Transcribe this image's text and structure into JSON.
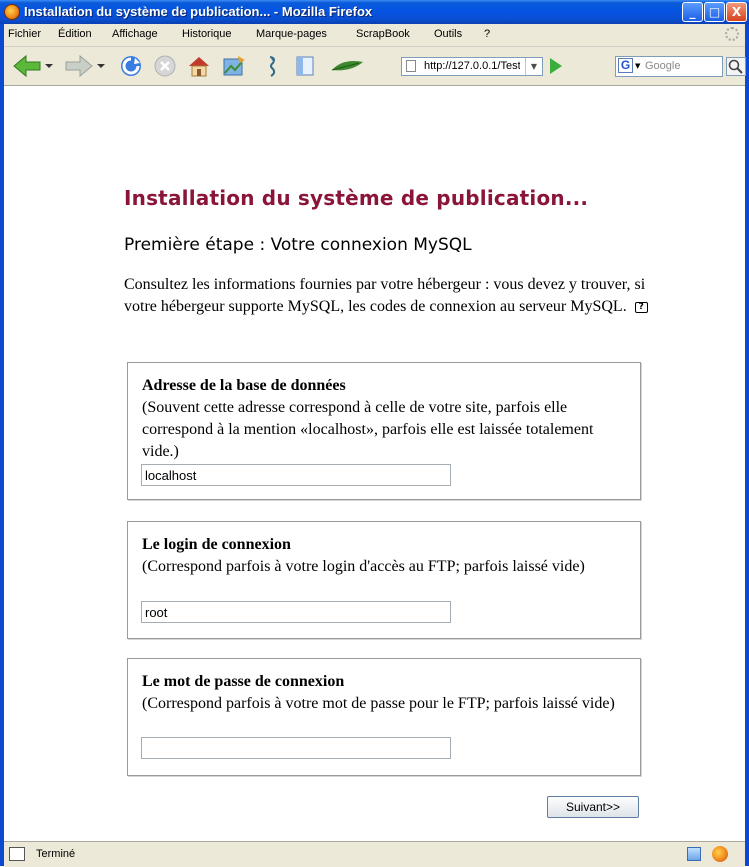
{
  "window": {
    "title": "Installation du système de publication... - Mozilla Firefox",
    "minimize": "_",
    "maximize": "□",
    "close": "X"
  },
  "menu": {
    "items": [
      "Fichier",
      "Édition",
      "Affichage",
      "Historique",
      "Marque-pages",
      "ScrapBook",
      "Outils",
      "?"
    ]
  },
  "toolbar": {
    "url": "http://127.0.0.1/Test",
    "search_placeholder": "Google",
    "search_engine_letter": "G"
  },
  "page": {
    "title": "Installation du système de publication...",
    "step_prefix": "Première étape :",
    "step_name": "Votre connexion MySQL",
    "intro": "Consultez les informations fournies par votre hébergeur : vous devez y trouver, si votre hébergeur supporte MySQL, les codes de connexion au serveur MySQL.",
    "help_icon_label": "?",
    "fields": [
      {
        "label": "Adresse de la base de données",
        "help": "(Souvent cette adresse correspond à celle de votre site, parfois elle correspond à la mention «localhost», parfois elle est laissée totalement vide.)",
        "value": "localhost"
      },
      {
        "label": "Le login de connexion",
        "help": "(Correspond parfois à votre login d'accès au FTP; parfois laissé vide)",
        "value": "root"
      },
      {
        "label": "Le mot de passe de connexion",
        "help": "(Correspond parfois à votre mot de passe pour le FTP; parfois laissé vide)",
        "value": ""
      }
    ],
    "submit_label": "Suivant>>"
  },
  "status": {
    "text": "Terminé"
  },
  "colors": {
    "title_color": "#8a1538",
    "titlebar_blue": "#0554e3",
    "chrome_beige": "#ece9d8"
  }
}
